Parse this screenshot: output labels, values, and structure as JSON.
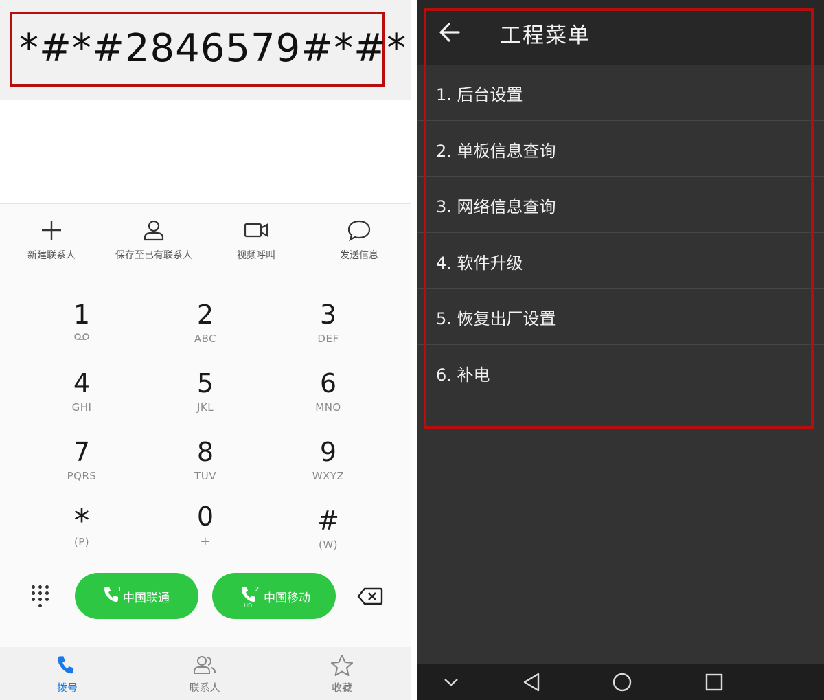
{
  "dialer": {
    "number": "*#*#2846579#*#*",
    "actions": [
      {
        "label": "新建联系人",
        "icon": "plus-icon"
      },
      {
        "label": "保存至已有联系人",
        "icon": "person-icon"
      },
      {
        "label": "视频呼叫",
        "icon": "video-camera-icon"
      },
      {
        "label": "发送信息",
        "icon": "message-bubble-icon"
      }
    ],
    "keys": [
      {
        "digit": "1",
        "sub": ""
      },
      {
        "digit": "2",
        "sub": "ABC"
      },
      {
        "digit": "3",
        "sub": "DEF"
      },
      {
        "digit": "4",
        "sub": "GHI"
      },
      {
        "digit": "5",
        "sub": "JKL"
      },
      {
        "digit": "6",
        "sub": "MNO"
      },
      {
        "digit": "7",
        "sub": "PQRS"
      },
      {
        "digit": "8",
        "sub": "TUV"
      },
      {
        "digit": "9",
        "sub": "WXYZ"
      },
      {
        "digit": "*",
        "sub": "(P)"
      },
      {
        "digit": "0",
        "sub": "+"
      },
      {
        "digit": "#",
        "sub": "(W)"
      }
    ],
    "call_buttons": [
      {
        "label": "中国联通",
        "sim": "1",
        "badge": ""
      },
      {
        "label": "中国移动",
        "sim": "2",
        "badge": "HD"
      }
    ],
    "bottom_nav": [
      {
        "label": "拨号",
        "icon": "phone-icon",
        "active": true
      },
      {
        "label": "联系人",
        "icon": "contacts-icon",
        "active": false
      },
      {
        "label": "收藏",
        "icon": "star-icon",
        "active": false
      }
    ],
    "colors": {
      "call_green": "#2ec743",
      "active_blue": "#1a7ae8",
      "highlight_red": "#b80d0d"
    }
  },
  "engineering_menu": {
    "title": "工程菜单",
    "items": [
      "1. 后台设置",
      "2. 单板信息查询",
      "3. 网络信息查询",
      "4. 软件升级",
      "5. 恢复出厂设置",
      "6. 补电"
    ],
    "system_nav": [
      "chevron-down-icon",
      "back-triangle-icon",
      "home-circle-icon",
      "recents-square-icon"
    ]
  }
}
